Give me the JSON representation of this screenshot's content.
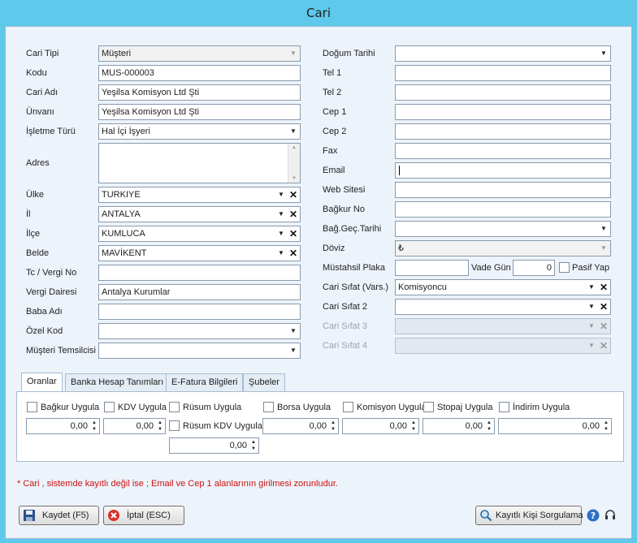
{
  "window": {
    "title": "Cari"
  },
  "left": {
    "cari_tipi": {
      "label": "Cari Tipi",
      "value": "Müşteri"
    },
    "kodu": {
      "label": "Kodu",
      "value": "MUS-000003"
    },
    "cari_adi": {
      "label": "Cari Adı",
      "value": "Yeşilsa Komisyon Ltd Şti"
    },
    "unvani": {
      "label": "Ünvanı",
      "value": "Yeşilsa Komisyon Ltd Şti"
    },
    "isletme_turu": {
      "label": "İşletme Türü",
      "value": "Hal İçi İşyeri"
    },
    "adres": {
      "label": "Adres",
      "value": ""
    },
    "ulke": {
      "label": "Ülke",
      "value": "TURKIYE"
    },
    "il": {
      "label": "İl",
      "value": "ANTALYA"
    },
    "ilce": {
      "label": "İlçe",
      "value": "KUMLUCA"
    },
    "belde": {
      "label": "Belde",
      "value": "MAVİKENT"
    },
    "tc_vergi": {
      "label": "Tc / Vergi No",
      "value": ""
    },
    "vergi_dairesi": {
      "label": "Vergi Dairesi",
      "value": "Antalya Kurumlar"
    },
    "baba_adi": {
      "label": "Baba Adı",
      "value": ""
    },
    "ozel_kod": {
      "label": "Özel Kod",
      "value": ""
    },
    "musteri_temsilcisi": {
      "label": "Müşteri Temsilcisi",
      "value": ""
    }
  },
  "right": {
    "dogum_tarihi": {
      "label": "Doğum Tarihi",
      "value": ""
    },
    "tel1": {
      "label": "Tel 1",
      "value": ""
    },
    "tel2": {
      "label": "Tel 2",
      "value": ""
    },
    "cep1": {
      "label": "Cep 1",
      "value": ""
    },
    "cep2": {
      "label": "Cep 2",
      "value": ""
    },
    "fax": {
      "label": "Fax",
      "value": ""
    },
    "email": {
      "label": "Email",
      "value": ""
    },
    "web": {
      "label": "Web Sitesi",
      "value": ""
    },
    "bagkur_no": {
      "label": "Bağkur No",
      "value": ""
    },
    "bag_gec_tarihi": {
      "label": "Bağ.Geç.Tarihi",
      "value": ""
    },
    "doviz": {
      "label": "Döviz",
      "value": "₺"
    },
    "mustahsil_plaka": {
      "label": "Müstahsil Plaka",
      "value": ""
    },
    "vade_gun": {
      "label": "Vade Gün",
      "value": "0"
    },
    "pasif_yap": {
      "label": "Pasif Yap"
    },
    "cari_sifat_vars": {
      "label": "Cari Sıfat (Vars.)",
      "value": "Komisyoncu"
    },
    "cari_sifat2": {
      "label": "Cari Sıfat 2",
      "value": ""
    },
    "cari_sifat3": {
      "label": "Cari Sıfat 3",
      "value": ""
    },
    "cari_sifat4": {
      "label": "Cari Sıfat 4",
      "value": ""
    }
  },
  "tabs": [
    {
      "label": "Oranlar"
    },
    {
      "label": "Banka Hesap Tanımları"
    },
    {
      "label": "E-Fatura Bilgileri"
    },
    {
      "label": "Şubeler"
    }
  ],
  "oranlar": {
    "bagkur": {
      "label": "Bağkur Uygula",
      "value": "0,00"
    },
    "kdv": {
      "label": "KDV Uygula",
      "value": "0,00"
    },
    "rusum": {
      "label": "Rüsum Uygula"
    },
    "rusum_kdv": {
      "label": "Rüsum KDV Uygula",
      "value": "0,00"
    },
    "borsa": {
      "label": "Borsa Uygula",
      "value": "0,00"
    },
    "komisyon": {
      "label": "Komisyon Uygula",
      "value": "0,00"
    },
    "stopaj": {
      "label": "Stopaj Uygula",
      "value": "0,00"
    },
    "indirim": {
      "label": "İndirim Uygula",
      "value": "0,00"
    }
  },
  "note": "* Cari , sistemde kayıtlı değil ise ; Email ve Cep 1 alanlarının girilmesi zorunludur.",
  "buttons": {
    "kaydet": "Kaydet (F5)",
    "iptal": "İptal (ESC)",
    "sorgula": "Kayıtlı Kişi Sorgulama"
  }
}
